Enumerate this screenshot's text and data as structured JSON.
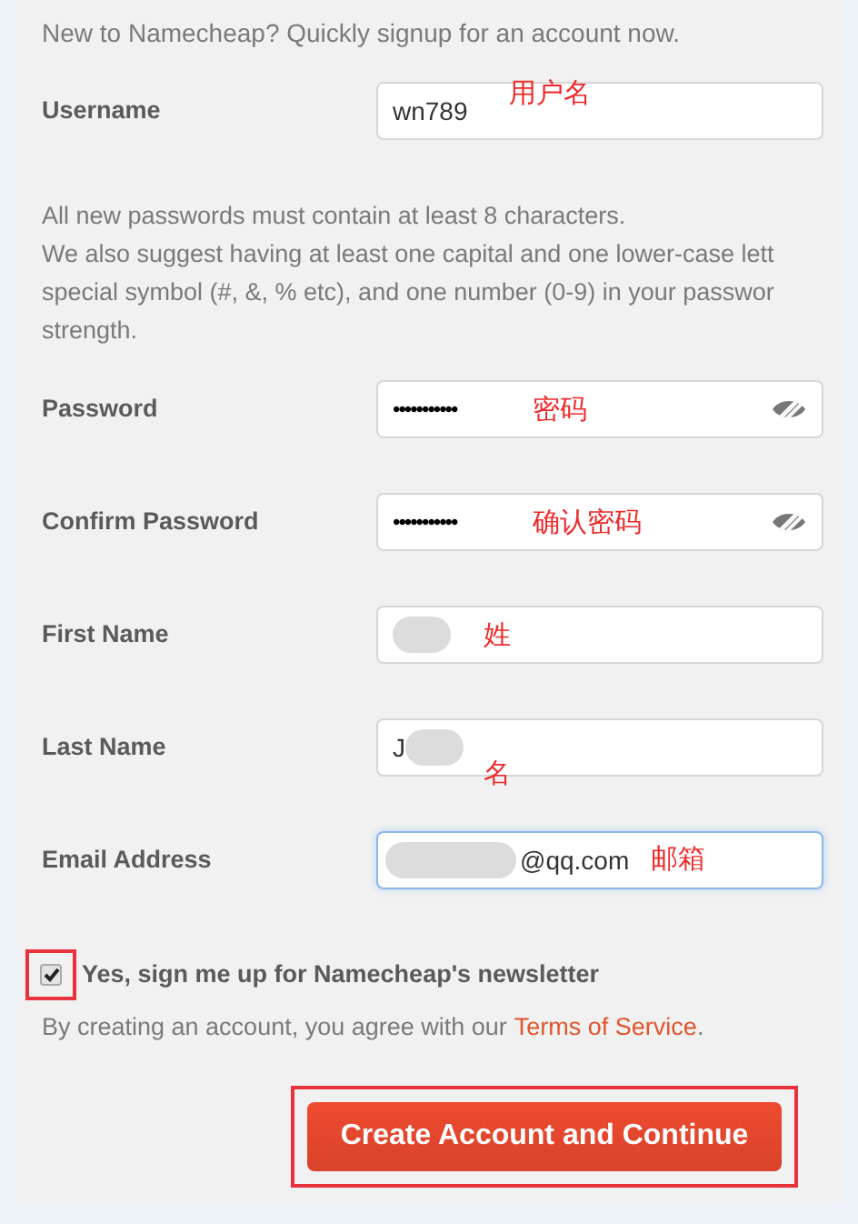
{
  "intro": "New to Namecheap? Quickly signup for an account now.",
  "username": {
    "label": "Username",
    "value": "wn789",
    "annotation": "用户名"
  },
  "password_hint": [
    "All new passwords must contain at least 8 characters.",
    "We also suggest having at least one capital and one lower-case lett",
    "special symbol (#, &, % etc), and one number (0-9) in your passwor",
    "strength."
  ],
  "fields": [
    {
      "label": "Password",
      "value": "•••••••••••",
      "kind": "password",
      "annotation": "密码"
    },
    {
      "label": "Confirm Password",
      "value": "•••••••••••",
      "kind": "password",
      "annotation": "确认密码"
    },
    {
      "label": "First Name",
      "kind": "text",
      "annotation": "姓",
      "redacted": true
    },
    {
      "label": "Last Name",
      "value": "J",
      "kind": "text",
      "annotation": "名",
      "redacted": true
    },
    {
      "label": "Email Address",
      "value": "@qq.com",
      "kind": "email",
      "annotation": "邮箱",
      "focused": true,
      "redacted": true
    }
  ],
  "newsletter": {
    "label": "Yes, sign me up for Namecheap's newsletter",
    "checked": true,
    "highlighted": true
  },
  "terms": {
    "text": "By creating an account, you agree with our",
    "link": "Terms of Service",
    "end": "."
  },
  "submit": {
    "label": "Create Account and Continue",
    "highlighted": true
  }
}
